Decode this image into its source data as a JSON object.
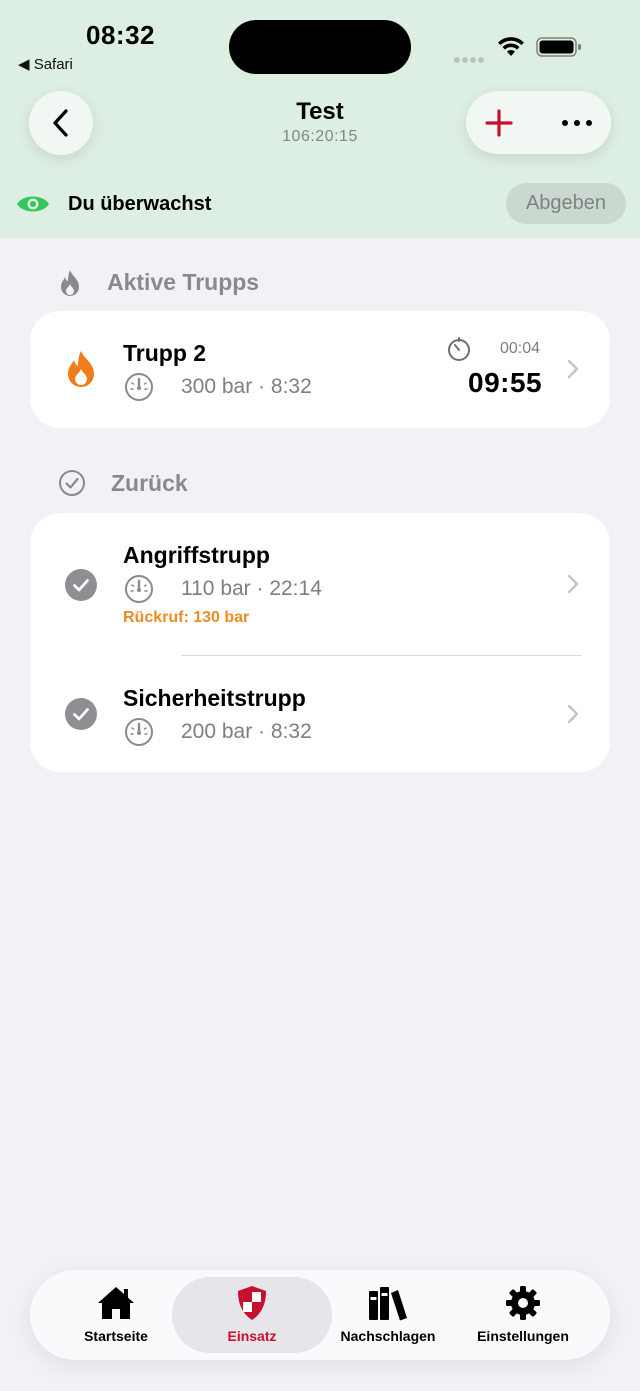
{
  "status_bar": {
    "time": "08:32",
    "back_app": "◀ Safari"
  },
  "nav": {
    "title": "Test",
    "subtitle": "106:20:15"
  },
  "watch": {
    "label": "Du überwachst",
    "button": "Abgeben"
  },
  "sections": {
    "active": {
      "title": "Aktive Trupps",
      "items": [
        {
          "name": "Trupp 2",
          "info": "300 bar · 8:32",
          "timer_small": "00:04",
          "timer_big": "09:55"
        }
      ]
    },
    "returned": {
      "title": "Zurück",
      "items": [
        {
          "name": "Angriffstrupp",
          "info": "110 bar · 22:14",
          "recall": "Rückruf: 130 bar"
        },
        {
          "name": "Sicherheitstrupp",
          "info": "200 bar · 8:32"
        }
      ]
    }
  },
  "tabs": [
    {
      "label": "Startseite",
      "icon": "house-icon"
    },
    {
      "label": "Einsatz",
      "icon": "shield-icon",
      "active": true
    },
    {
      "label": "Nachschlagen",
      "icon": "books-icon"
    },
    {
      "label": "Einstellungen",
      "icon": "gear-icon"
    }
  ],
  "colors": {
    "header_bg": "#ddeee2",
    "accent_red": "#c8102e",
    "eye_green": "#34c759",
    "flame_orange": "#f27c1c",
    "recall_orange": "#f08a24"
  }
}
